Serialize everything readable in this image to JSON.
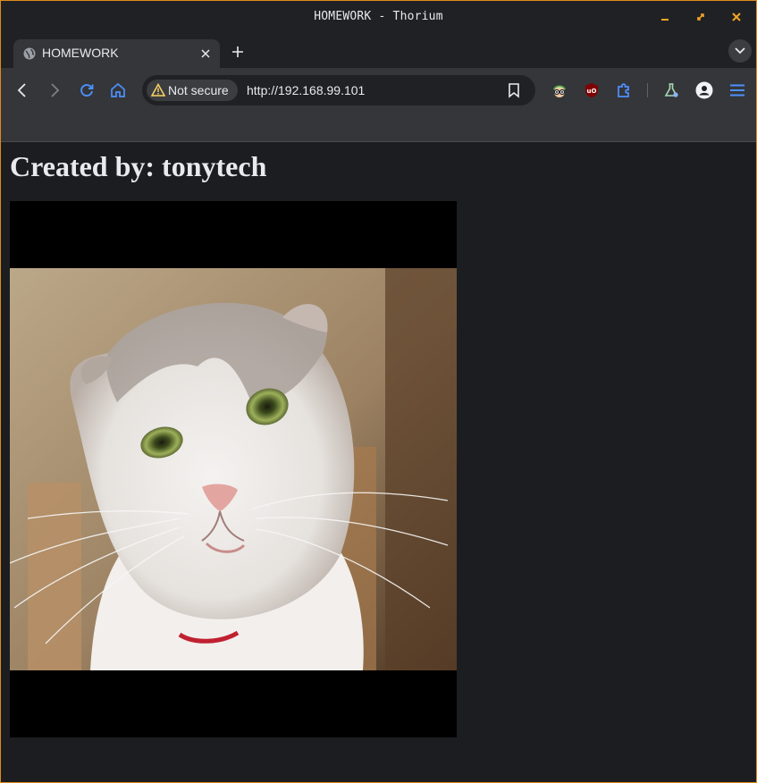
{
  "window": {
    "title": "HOMEWORK - Thorium"
  },
  "tab": {
    "title": "HOMEWORK"
  },
  "omnibox": {
    "security_label": "Not secure",
    "url": "http://192.168.99.101"
  },
  "page": {
    "heading": "Created by: tonytech"
  },
  "icons": {
    "favicon": "globe-icon",
    "tab_close": "close-icon",
    "new_tab": "plus-icon",
    "tab_search": "chevron-down-icon",
    "back": "arrow-left-icon",
    "forward": "arrow-right-icon",
    "reload": "reload-icon",
    "home": "home-icon",
    "security": "warning-icon",
    "bookmark": "bookmark-icon",
    "extensions": [
      "spy-extension-icon",
      "ublock-origin-icon",
      "puzzle-icon",
      "labs-flask-icon"
    ],
    "profile": "profile-icon",
    "menu": "hamburger-menu-icon"
  },
  "colors": {
    "window_border": "#e08a1a",
    "window_controls": "#f5a623",
    "accent_blue": "#4d90fe",
    "page_background": "#1c1d20"
  }
}
